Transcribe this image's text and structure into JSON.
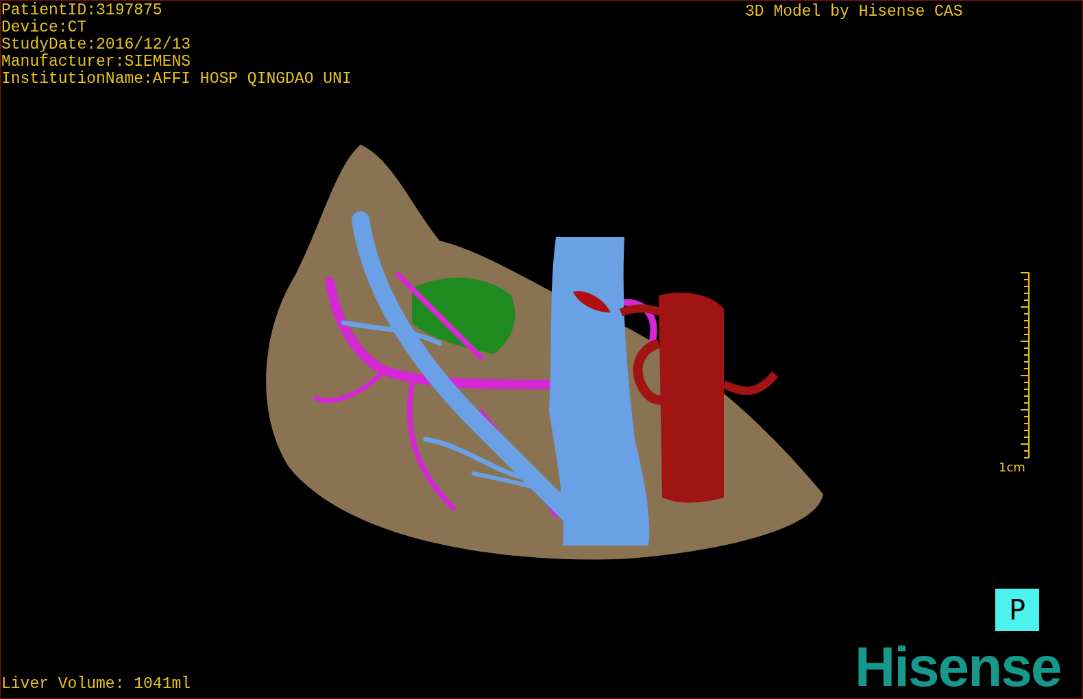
{
  "info_lines": [
    "PatientID:3197875",
    "Device:CT",
    "StudyDate:2016/12/13",
    "Manufacturer:SIEMENS",
    "InstitutionName:AFFI HOSP QINGDAO UNI"
  ],
  "credit": "3D Model by Hisense CAS",
  "scale_bar": {
    "label": "1cm"
  },
  "view_button": {
    "label": "P"
  },
  "volume": "Liver Volume: 1041ml",
  "logo": {
    "text": "Hisense"
  }
}
